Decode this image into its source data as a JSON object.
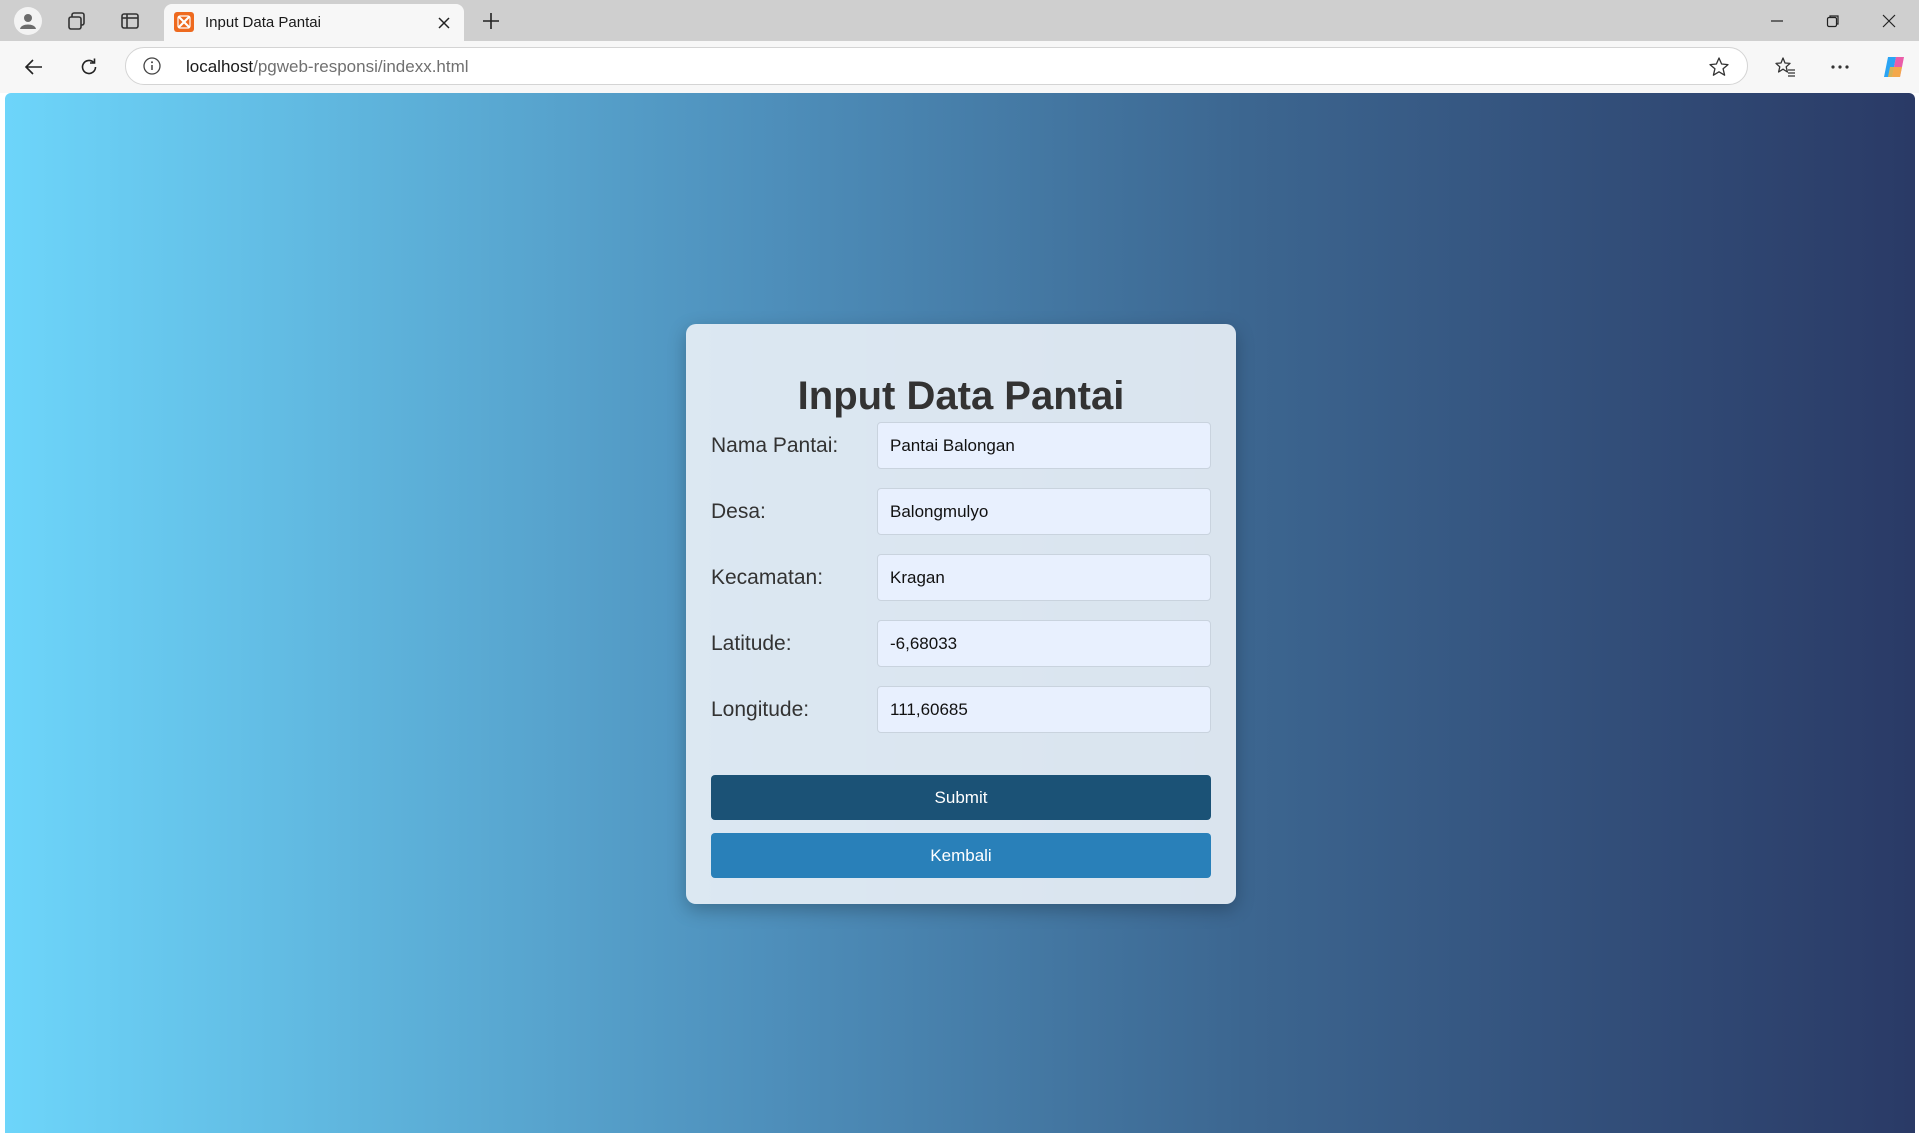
{
  "browser": {
    "tab_title": "Input Data Pantai",
    "url_host": "localhost",
    "url_path": "/pgweb-responsi/indexx.html"
  },
  "form": {
    "title": "Input Data Pantai",
    "fields": [
      {
        "label": "Nama Pantai:",
        "value": "Pantai Balongan"
      },
      {
        "label": "Desa:",
        "value": "Balongmulyo"
      },
      {
        "label": "Kecamatan:",
        "value": "Kragan"
      },
      {
        "label": "Latitude:",
        "value": "-6,68033"
      },
      {
        "label": "Longitude:",
        "value": "111,60685"
      }
    ],
    "submit_label": "Submit",
    "back_label": "Kembali"
  },
  "colors": {
    "gradient_start": "#6dd5fa",
    "gradient_end": "#2a3a66",
    "submit_button": "#1b5276",
    "back_button": "#2980b9",
    "input_bg": "#e8f0fe",
    "favicon": "#ee6a1f"
  },
  "icons": [
    "profile-icon",
    "workspaces-icon",
    "tab-actions-icon",
    "xampp-favicon-icon",
    "close-tab-icon",
    "new-tab-icon",
    "minimize-icon",
    "restore-icon",
    "close-window-icon",
    "back-icon",
    "refresh-icon",
    "site-info-icon",
    "favorite-star-icon",
    "favorites-icon",
    "more-icon",
    "copilot-icon"
  ]
}
